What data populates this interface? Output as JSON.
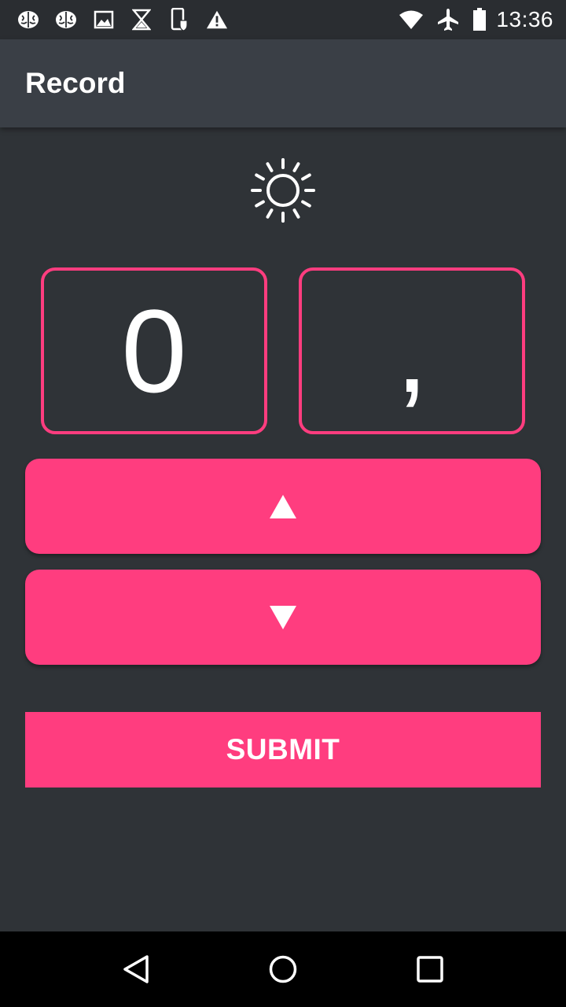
{
  "status_bar": {
    "time": "13:36",
    "left_icons": [
      "brain-icon",
      "brain-icon",
      "image-icon",
      "hourglass-icon",
      "phone-shield-icon",
      "warning-icon"
    ],
    "right_icons": [
      "wifi-icon",
      "airplane-mode-icon",
      "battery-icon"
    ]
  },
  "app_bar": {
    "title": "Record"
  },
  "record": {
    "weather_icon": "sun-icon",
    "digit_left": "0",
    "digit_right": ","
  },
  "controls": {
    "up_label": "▲",
    "down_label": "▼",
    "submit_label": "SUBMIT"
  },
  "nav_bar": {
    "icons": [
      "back-icon",
      "home-icon",
      "recents-icon"
    ]
  },
  "colors": {
    "accent": "#ff3d7f",
    "background": "#2f3337",
    "app_bar": "#3a3f46",
    "status_bar": "#2a2d31"
  }
}
